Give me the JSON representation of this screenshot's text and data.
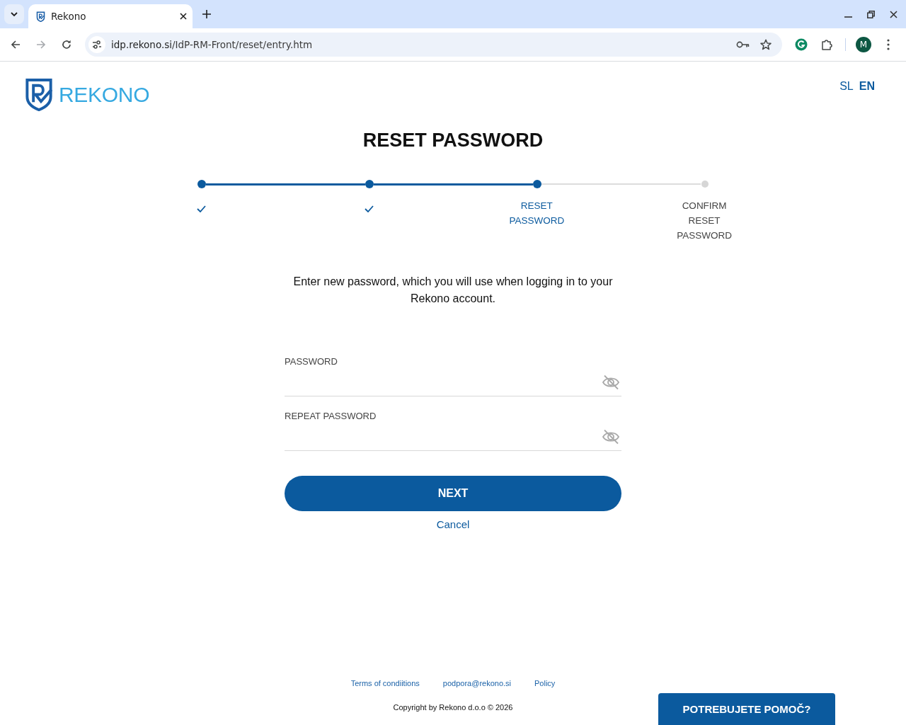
{
  "browser": {
    "tab": {
      "title": "Rekono"
    },
    "address": {
      "domain": "idp.rekono.si",
      "path": "/IdP-RM-Front/reset/entry.htm"
    },
    "profile_initial": "M"
  },
  "header": {
    "logo_text": "REKONO",
    "languages": [
      {
        "label": "SL",
        "selected": false
      },
      {
        "label": "EN",
        "selected": true
      }
    ]
  },
  "title": "RESET PASSWORD",
  "steps": [
    {
      "completed": true,
      "current": false
    },
    {
      "completed": true,
      "current": false
    },
    {
      "completed": false,
      "current": true,
      "label": "RESET PASSWORD"
    },
    {
      "completed": false,
      "current": false,
      "label": "CONFIRM RESET PASSWORD"
    }
  ],
  "intro": "Enter new password, which you will use when logging in to your Rekono account.",
  "fields": [
    {
      "label": "PASSWORD"
    },
    {
      "label": "REPEAT PASSWORD"
    }
  ],
  "next_button": "NEXT",
  "cancel_link": "Cancel",
  "footer": {
    "links": [
      "Terms of condiitions",
      "podpora@rekono.si",
      "Policy"
    ],
    "copyright": "Copyright by Rekono d.o.o © 2026"
  },
  "help_button": "POTREBUJETE POMOČ?"
}
